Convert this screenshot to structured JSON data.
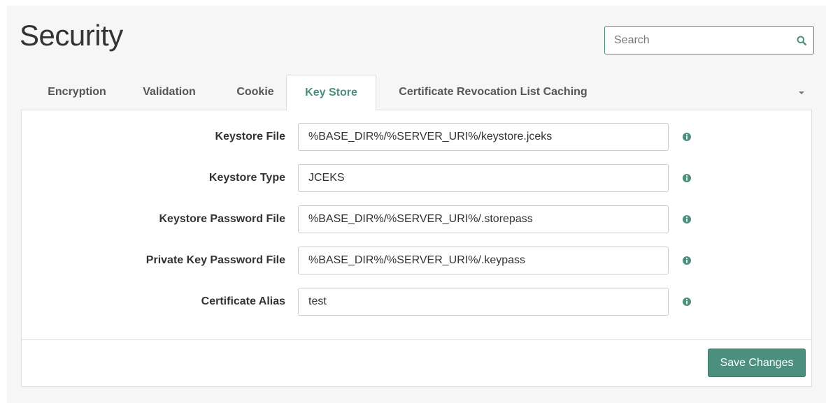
{
  "header": {
    "title": "Security"
  },
  "search": {
    "placeholder": "Search",
    "value": "",
    "icon": "search-icon"
  },
  "tabs": [
    {
      "label": "Encryption",
      "active": false
    },
    {
      "label": "Validation",
      "active": false
    },
    {
      "label": "Cookie",
      "active": false
    },
    {
      "label": "Key Store",
      "active": true
    },
    {
      "label": "Certificate Revocation List Caching",
      "active": false
    }
  ],
  "tabs_more_icon": "caret-down-icon",
  "form": {
    "fields": [
      {
        "label": "Keystore File",
        "value": "%BASE_DIR%/%SERVER_URI%/keystore.jceks",
        "icon": "info-icon"
      },
      {
        "label": "Keystore Type",
        "value": "JCEKS",
        "icon": "info-icon"
      },
      {
        "label": "Keystore Password File",
        "value": "%BASE_DIR%/%SERVER_URI%/.storepass",
        "icon": "info-icon"
      },
      {
        "label": "Private Key Password File",
        "value": "%BASE_DIR%/%SERVER_URI%/.keypass",
        "icon": "info-icon"
      },
      {
        "label": "Certificate Alias",
        "value": "test",
        "icon": "info-icon"
      }
    ]
  },
  "footer": {
    "save_label": "Save Changes"
  },
  "colors": {
    "accent": "#4d8f7f",
    "background": "#f6f6f6",
    "panel": "#ffffff",
    "border": "#dddddd"
  }
}
